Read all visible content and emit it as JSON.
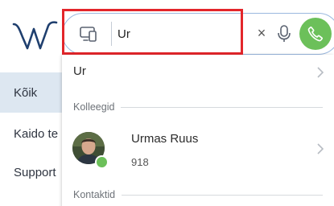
{
  "app": {
    "logo_icon": "w-logo-icon",
    "nav": [
      {
        "label": "Kõik"
      },
      {
        "label": "Kaido te"
      },
      {
        "label": "Support"
      }
    ]
  },
  "search": {
    "value": "Ur",
    "type_icon": "device-switch-icon",
    "clear_label": "×",
    "mic_icon": "mic-icon",
    "call_icon": "phone-icon",
    "highlight_color": "#e3262b",
    "call_color": "#6cc05a"
  },
  "dropdown": {
    "suggestion": "Ur",
    "colleagues_header": "Kolleegid",
    "colleague": {
      "name": "Urmas Ruus",
      "extension": "918",
      "status_color": "#6cc05a"
    },
    "contacts_header": "Kontaktid"
  }
}
